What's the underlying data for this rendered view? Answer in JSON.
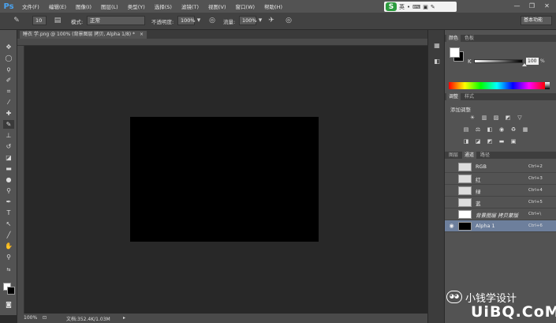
{
  "app": {
    "logo": "Ps"
  },
  "menu": [
    "文件(F)",
    "编辑(E)",
    "图像(I)",
    "图层(L)",
    "类型(Y)",
    "选择(S)",
    "滤镜(T)",
    "视图(V)",
    "窗口(W)",
    "帮助(H)"
  ],
  "ime": {
    "logo": "S",
    "mode": "英"
  },
  "window_controls": {
    "minimize": "—",
    "restore": "❐",
    "close": "✕"
  },
  "options": {
    "brush_size": "10",
    "mode_label": "模式:",
    "mode_value": "正常",
    "opacity_label": "不透明度:",
    "opacity_value": "100%",
    "flow_label": "流量:",
    "flow_value": "100%",
    "workspace": "基本功能"
  },
  "document": {
    "tab_title": "睡衣 学.png @ 100% (背景图层 拷贝, Alpha 1/8) *",
    "tab_close": "×"
  },
  "status": {
    "zoom": "100%",
    "doc_info": "文档:352.4K/1.03M"
  },
  "color_panel": {
    "tabs": [
      "颜色",
      "色板"
    ],
    "channel_label": "K",
    "value": "100",
    "unit": "%",
    "k_level": 100
  },
  "adjust_panel": {
    "tabs": [
      "调整",
      "样式"
    ],
    "title": "添加调整"
  },
  "channels_panel": {
    "tabs": [
      "图层",
      "通道",
      "路径"
    ],
    "rows": [
      {
        "name": "RGB",
        "shortcut": "Ctrl+2"
      },
      {
        "name": "红",
        "shortcut": "Ctrl+3"
      },
      {
        "name": "绿",
        "shortcut": "Ctrl+4"
      },
      {
        "name": "蓝",
        "shortcut": "Ctrl+5"
      },
      {
        "name": "背景图层 拷贝蒙版",
        "shortcut": "Ctrl+\\"
      },
      {
        "name": "Alpha 1",
        "shortcut": "Ctrl+6"
      }
    ]
  },
  "watermark": {
    "text": "小钱学设计",
    "site": "UiBQ.CoM"
  },
  "colors": {
    "accent": "#4aa3f0",
    "selected_row": "#6d7f9c",
    "canvas": "#000000"
  }
}
